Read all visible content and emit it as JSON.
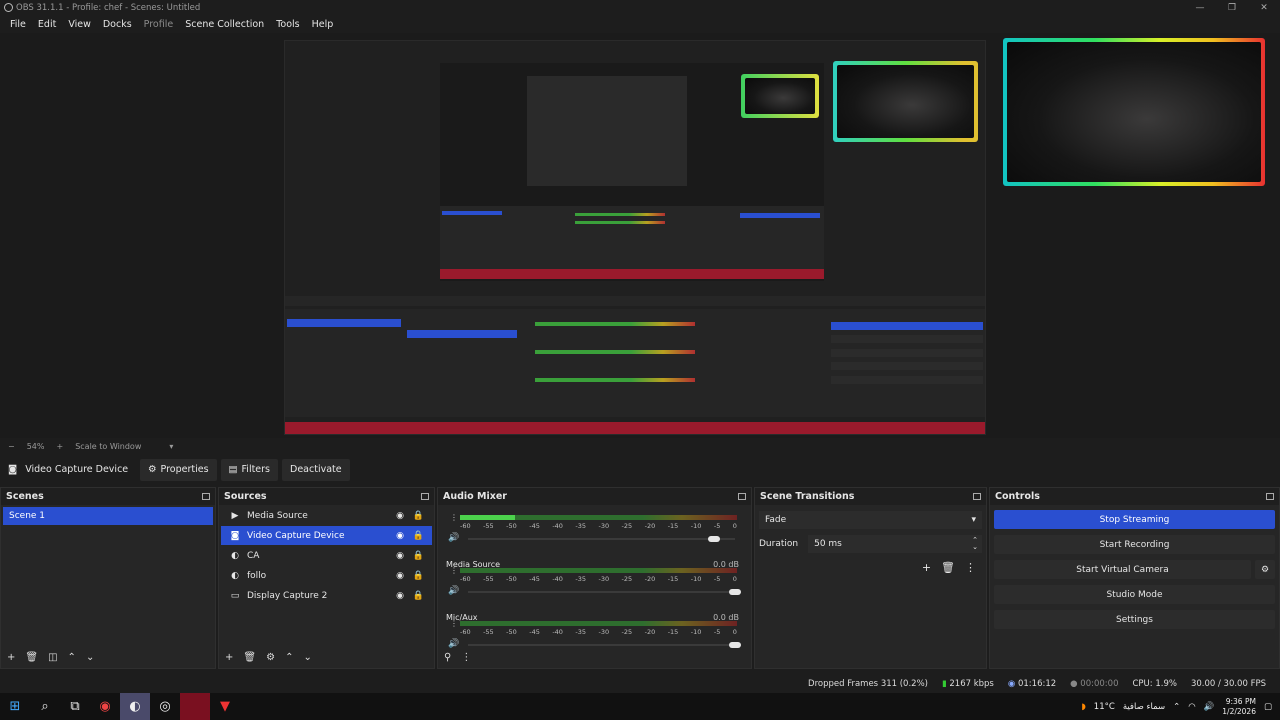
{
  "window": {
    "title": "OBS 31.1.1 - Profile: chef - Scenes: Untitled"
  },
  "menu": {
    "items": [
      "File",
      "Edit",
      "View",
      "Docks",
      "Profile",
      "Scene Collection",
      "Tools",
      "Help"
    ]
  },
  "preview": {
    "zoom": "54%",
    "scale_mode": "Scale to Window"
  },
  "source_toolbar": {
    "source_name": "Video Capture Device",
    "properties": "Properties",
    "filters": "Filters",
    "deactivate": "Deactivate"
  },
  "scenes": {
    "title": "Scenes",
    "items": [
      "Scene 1"
    ],
    "selected": 0
  },
  "sources": {
    "title": "Sources",
    "items": [
      {
        "name": "Media Source",
        "icon": "play-icon"
      },
      {
        "name": "Video Capture Device",
        "icon": "camera-icon"
      },
      {
        "name": "CA",
        "icon": "globe-icon"
      },
      {
        "name": "follo",
        "icon": "globe-icon"
      },
      {
        "name": "Display Capture 2",
        "icon": "monitor-icon"
      }
    ],
    "selected": 1
  },
  "mixer": {
    "title": "Audio Mixer",
    "ticks": [
      "-60",
      "-55",
      "-50",
      "-45",
      "-40",
      "-35",
      "-30",
      "-25",
      "-20",
      "-15",
      "-10",
      "-5",
      "0"
    ],
    "channels": [
      {
        "name": "",
        "db": "",
        "level": 0.2,
        "volume": 0.92
      },
      {
        "name": "Media Source",
        "db": "0.0 dB",
        "level": 0.0,
        "volume": 1.0
      },
      {
        "name": "Mic/Aux",
        "db": "0.0 dB",
        "level": 0.0,
        "volume": 1.0
      }
    ]
  },
  "transitions": {
    "title": "Scene Transitions",
    "type": "Fade",
    "duration_label": "Duration",
    "duration": "50 ms"
  },
  "controls": {
    "title": "Controls",
    "buttons": [
      "Stop Streaming",
      "Start Recording",
      "Start Virtual Camera",
      "Studio Mode",
      "Settings"
    ]
  },
  "status": {
    "dropped_frames": "Dropped Frames 311 (0.2%)",
    "bitrate": "2167 kbps",
    "stream_time": "01:16:12",
    "rec_time": "00:00:00",
    "cpu": "CPU: 1.9%",
    "fps": "30.00 / 30.00 FPS"
  },
  "taskbar": {
    "weather": "11°C",
    "weather_desc": "سماء صافية",
    "time": "9:36 PM",
    "date": "1/2/2026"
  }
}
